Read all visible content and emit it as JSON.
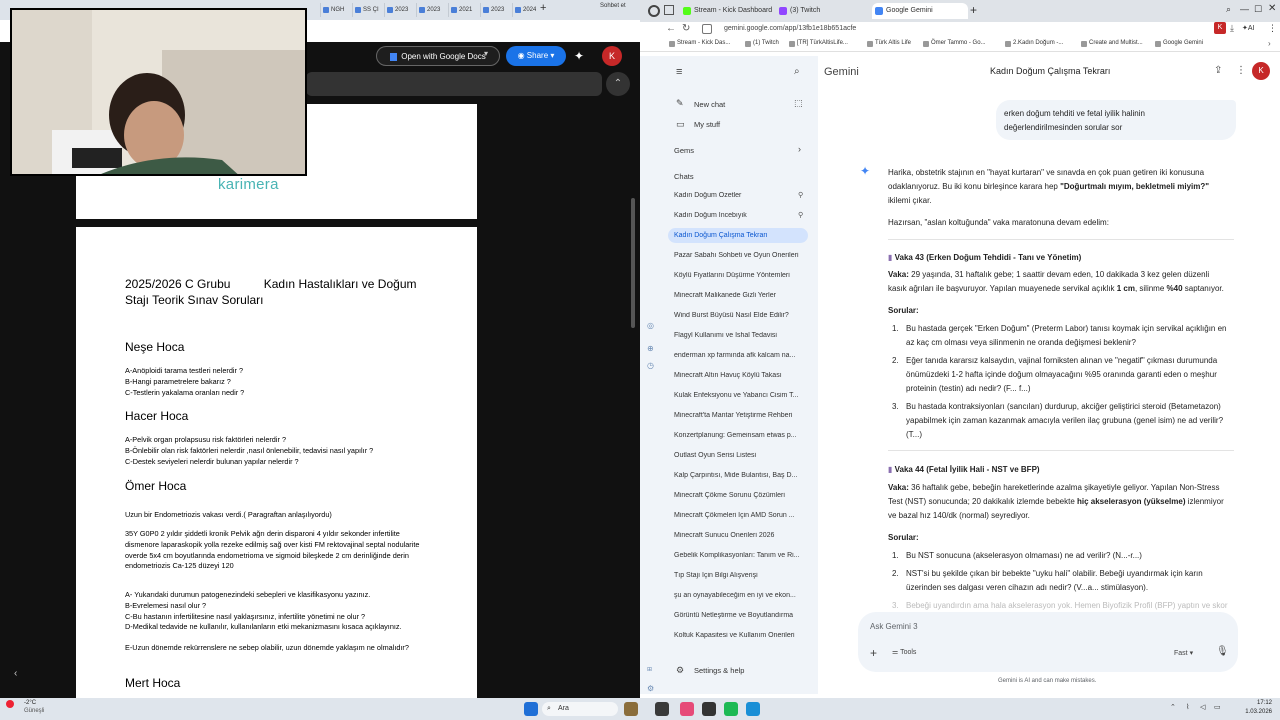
{
  "left_tabs": [
    "NGH",
    "SS ÇI",
    "2023",
    "2023",
    "2021",
    "2023",
    "2024"
  ],
  "left_profile": "Sohbet et",
  "docs_toolbar": {
    "open_with": "Open with Google Docs",
    "share": "Share",
    "avatar": "K"
  },
  "doc": {
    "brand": "karimera",
    "title_line1": "2025/2026 C Grubu          Kadın Hastalıkları ve Doğum",
    "title_line2": "Stajı Teorik Sınav Soruları",
    "sections": [
      {
        "heading": "Neşe Hoca",
        "lines": [
          "A-Anöploidi tarama testleri nelerdir ?",
          "B-Hangi parametrelere bakarız ?",
          "C-Testlerin yakalama oranları nedir ?"
        ]
      },
      {
        "heading": "Hacer Hoca",
        "lines": [
          "A-Pelvik organ prolapsusu risk faktörleri nelerdir ?",
          "B-Önlebilir olan risk faktörleri nelerdir ,nasıl önlenebilir, tedavisi nasıl yapılır ?",
          "C-Destek seviyeleri nelerdir bulunan yapılar nelerdir ?"
        ]
      },
      {
        "heading": "Ömer Hoca",
        "intro": "Uzun bir Endometriozis vakası verdi.( Paragraftan anlaşılıyordu)",
        "case": "35Y G0P0 2 yıldır şiddetli kronik Pelvik ağrı derin disparoni 4 yıldır sekonder infertilite dismenore laparaskopik yolla rezeke edilmiş sağ over kisti FM rektovajinal septal nodularite overde 5x4 cm boyutlarında endometrioma ve sigmoid bileşkede 2 cm derinliğinde derin endometriozis Ca-125 düzeyi 120",
        "lines": [
          "A- Yukarıdaki durumun patogenezindeki sebepleri ve klasifikasyonu yazınız.",
          "B-Evrelemesi nasıl olur ?",
          "C-Bu hastanın infertilitesine nasıl yaklaşırsınız, infertilite yönetimi ne olur ?",
          "D-Medikal tedavide ne kullanılır, kullanılanların etki mekanizmasını kısaca açıklayınız.",
          "E-Uzun dönemde rekürrenslere ne  sebep olabilir, uzun dönemde yaklaşım ne olmalıdır?"
        ]
      },
      {
        "heading": "Mert Hoca"
      }
    ]
  },
  "right_tabs": [
    {
      "label": "Stream - Kick Dashboard",
      "color": "#53fc18"
    },
    {
      "label": "(3) Twitch",
      "color": "#9146ff"
    },
    {
      "label": "Google Gemini",
      "color": "#4285f4"
    }
  ],
  "url": "gemini.google.com/app/13fb1e18b651acfe",
  "bookmarks": [
    "Stream - Kick Das...",
    "(1) Twitch",
    "[TR] TürkAltisLife...",
    "Türk Altis Life",
    "Ömer Tammo - Go...",
    "2.Kadın Doğum -...",
    "Create and Multist...",
    "Google Gemini"
  ],
  "browser_avatar": "K",
  "browser_ai": "AI",
  "gemini": {
    "logo": "Gemini",
    "conversation_title": "Kadın Doğum Çalışma Tekrarı",
    "new_chat": "New chat",
    "my_stuff": "My stuff",
    "gems": "Gems",
    "chats": "Chats",
    "chat_list": [
      "Kadın Doğum Özetler",
      "Kadın Doğum İncebıyık",
      "Kadın Doğum Çalışma Tekrarı",
      "Pazar Sabahı Sohbeti ve Oyun Önerileri",
      "Köylü Fiyatlarını Düşürme Yöntemleri",
      "Minecraft Malikanede Gizli Yerler",
      "Wind Burst Büyüsü Nasıl Elde Edilir?",
      "Flagyl Kullanımı ve İshal Tedavisi",
      "enderman xp farmında afk kalcam na...",
      "Minecraft Altın Havuç Köylü Takası",
      "Kulak Enfeksiyonu ve Yabancı Cisim T...",
      "Minecraft'ta Mantar Yetiştirme Rehberi",
      "Konzertplanung: Gemeinsam etwas p...",
      "Outlast Oyun Serisi Listesi",
      "Kalp Çarpıntısı, Mide Bulantısı, Baş D...",
      "Minecraft Çökme Sorunu Çözümleri",
      "Minecraft Çökmeleri İçin AMD Sorun ...",
      "Minecraft Sunucu Önerileri 2026",
      "Gebelik Komplikasyonları: Tanım ve Ri...",
      "Tıp Stajı İçin Bilgi Alışverişi",
      "şu an oynayabileceğim en iyi ve ekon...",
      "Görüntü Netleştirme ve Boyutlandırma",
      "Koltuk Kapasitesi ve Kullanım Önerileri"
    ],
    "settings": "Settings & help",
    "user_msg": "erken doğum tehditi ve fetal iyilik halinin değerlendirilmesinden sorular sor",
    "intro_1a": "Harika, obstetrik stajının en \"hayat kurtaran\" ve sınavda en çok puan getiren iki konusuna odaklanıyoruz. Bu iki konu birleşince karara hep ",
    "intro_1b": "\"Doğurtmalı mıyım, bekletmeli miyim?\"",
    "intro_1c": " ikilemi çıkar.",
    "intro_2": "Hazırsan, \"aslan koltuğunda\" vaka maratonuna devam edelim:",
    "case43_title": "Vaka 43 (Erken Doğum Tehdidi - Tanı ve Yönetim)",
    "case43_label": "Vaka:",
    "case43_text_a": " 29 yaşında, 31 haftalık gebe; 1 saattir devam eden, 10 dakikada 3 kez gelen düzenli kasık ağrıları ile başvuruyor. Yapılan muayenede servikal açıklık ",
    "case43_b1": "1 cm",
    "case43_text_b": ", silinme ",
    "case43_b2": "%40",
    "case43_text_c": " saptanıyor.",
    "questions_label": "Sorular:",
    "q43": [
      "Bu hastada gerçek \"Erken Doğum\" (Preterm Labor) tanısı koymak için servikal açıklığın en az kaç cm olması veya silinmenin ne oranda değişmesi beklenir?",
      "Eğer tanıda kararsız kalsaydın, vajinal forniksten alınan ve \"negatif\" çıkması durumunda önümüzdeki 1-2 hafta içinde doğum olmayacağını %95 oranında garanti eden o meşhur proteinin (testin) adı nedir? (F... f...)",
      "Bu hastada kontraksiyonları (sancıları) durdurup, akciğer geliştirici steroid (Betametazon) yapabilmek için zaman kazanmak amacıyla verilen ilaç grubuna (genel isim) ne ad verilir? (T...)"
    ],
    "case44_title": "Vaka 44 (Fetal İyilik Hali - NST ve BFP)",
    "case44_label": "Vaka:",
    "case44_text_a": " 36 haftalık gebe, bebeğin hareketlerinde azalma şikayetiyle geliyor. Yapılan Non-Stress Test (NST) sonucunda; 20 dakikalık izlemde bebekte ",
    "case44_b1": "hiç akselerasyon (yükselme)",
    "case44_text_b": " izlenmiyor ve bazal hız 140/dk (normal) seyrediyor.",
    "q44": [
      "Bu NST sonucuna (akselerasyon olmaması) ne ad verilir? (N...-r...)",
      "NST'si bu şekilde çıkan bir bebekte \"uyku hali\" olabilir. Bebeği uyandırmak için karın üzerinden ses dalgası veren cihazın adı nedir? (V...a... stimülasyon).",
      "Bebeği uyandırdın ama hala akselerasyon yok. Hemen Biyofizik Profil (BFP) yaptın ve skor"
    ],
    "input_placeholder": "Ask Gemini 3",
    "tools": "Tools",
    "mode": "Fast",
    "disclaimer": "Gemini is AI and can make mistakes.",
    "avatar": "K"
  },
  "taskbar": {
    "weather_temp": "-2°C",
    "weather_desc": "Güneşli",
    "search": "Ara",
    "time": "17:12",
    "date": "1.03.2026"
  }
}
